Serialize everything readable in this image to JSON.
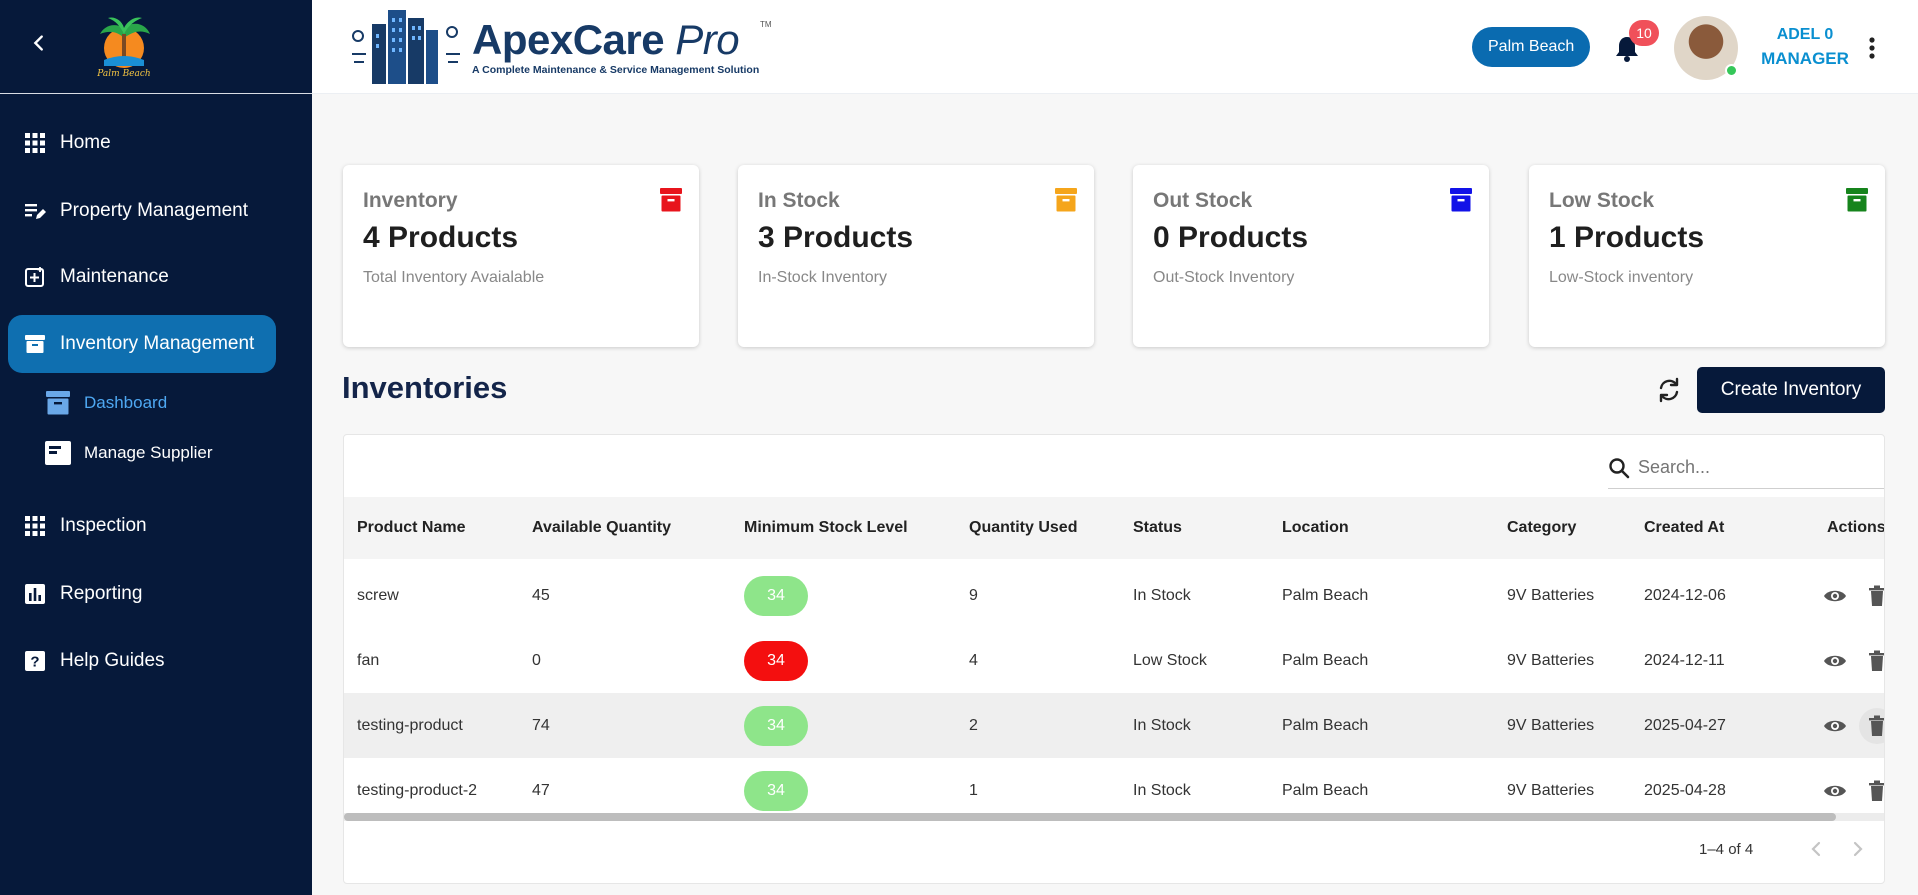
{
  "sidebar": {
    "logo_text": "Palm Beach",
    "items": [
      {
        "label": "Home",
        "icon": "grid-icon"
      },
      {
        "label": "Property Management",
        "icon": "edit-list-icon"
      },
      {
        "label": "Maintenance",
        "icon": "add-box-icon"
      },
      {
        "label": "Inventory Management",
        "icon": "archive-box-icon",
        "active": true
      },
      {
        "label": "Inspection",
        "icon": "grid-icon"
      },
      {
        "label": "Reporting",
        "icon": "bar-chart-icon"
      },
      {
        "label": "Help Guides",
        "icon": "help-icon"
      }
    ],
    "sub_items": [
      {
        "label": "Dashboard",
        "icon": "archive-box-icon",
        "active": true
      },
      {
        "label": "Manage Supplier",
        "icon": "card-icon"
      }
    ]
  },
  "header": {
    "brand_name": "ApexCare",
    "brand_suffix": "Pro",
    "brand_tm": "TM",
    "brand_tagline": "A Complete Maintenance & Service Management Solution",
    "location": "Palm Beach",
    "notification_count": "10",
    "user_name": "ADEL 0",
    "user_role": "MANAGER"
  },
  "stats": [
    {
      "title": "Inventory",
      "value": "4 Products",
      "subtitle": "Total Inventory Avaialable",
      "color": "#e8141c"
    },
    {
      "title": "In Stock",
      "value": "3 Products",
      "subtitle": "In-Stock Inventory",
      "color": "#f5a51b"
    },
    {
      "title": "Out Stock",
      "value": "0 Products",
      "subtitle": "Out-Stock Inventory",
      "color": "#1212e8"
    },
    {
      "title": "Low Stock",
      "value": "1 Products",
      "subtitle": "Low-Stock inventory",
      "color": "#16841c"
    }
  ],
  "inventories": {
    "title": "Inventories",
    "create_label": "Create Inventory",
    "search_placeholder": "Search...",
    "columns": [
      "Product Name",
      "Available Quantity",
      "Minimum Stock Level",
      "Quantity Used",
      "Status",
      "Location",
      "Category",
      "Created At",
      "Actions"
    ],
    "rows": [
      {
        "name": "screw",
        "available": "45",
        "min_level": "34",
        "level_color": "#8ee58a",
        "used": "9",
        "status": "In Stock",
        "location": "Palm Beach",
        "category": "9V Batteries",
        "created": "2024-12-06"
      },
      {
        "name": "fan",
        "available": "0",
        "min_level": "34",
        "level_color": "#f40f0f",
        "used": "4",
        "status": "Low Stock",
        "location": "Palm Beach",
        "category": "9V Batteries",
        "created": "2024-12-11"
      },
      {
        "name": "testing-product",
        "available": "74",
        "min_level": "34",
        "level_color": "#8ee58a",
        "used": "2",
        "status": "In Stock",
        "location": "Palm Beach",
        "category": "9V Batteries",
        "created": "2025-04-27"
      },
      {
        "name": "testing-product-2",
        "available": "47",
        "min_level": "34",
        "level_color": "#8ee58a",
        "used": "1",
        "status": "In Stock",
        "location": "Palm Beach",
        "category": "9V Batteries",
        "created": "2025-04-28"
      }
    ],
    "pagination": "1–4 of 4"
  }
}
